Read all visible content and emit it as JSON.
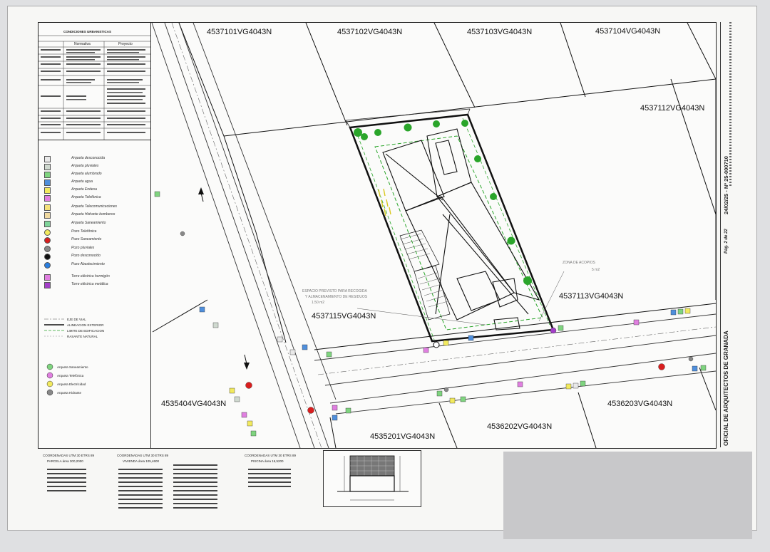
{
  "parcels": {
    "p1": "4537101VG4043N",
    "p2": "4537102VG4043N",
    "p3": "4537103VG4043N",
    "p4": "4537104VG4043N",
    "p5": "4537112VG4043N",
    "p6": "4537113VG4043N",
    "p7": "4537115VG4043N",
    "p8": "4535404VG4043N",
    "p9": "4536203VG4043N",
    "p10": "4536202VG4043N",
    "p11": "4535201VG4043N"
  },
  "conditions": {
    "title": "CONDICIONES URBANISTICAS",
    "col_norm": "Normativa",
    "col_proj": "Proyecto"
  },
  "legend": [
    {
      "label": "Arqueta desconocida",
      "color": "#e9e9e9",
      "shape": "sq"
    },
    {
      "label": "Arqueta pluviales",
      "color": "#cfd9cf",
      "shape": "sq"
    },
    {
      "label": "Arqueta alumbrado",
      "color": "#7fd47f",
      "shape": "sq"
    },
    {
      "label": "Arqueta agua",
      "color": "#4f8fdc",
      "shape": "sq"
    },
    {
      "label": "Arqueta Endesa",
      "color": "#f2ea5e",
      "shape": "sq"
    },
    {
      "label": "Arqueta Telefónica",
      "color": "#e07fe0",
      "shape": "sq"
    },
    {
      "label": "Arqueta Telecomunicaciones",
      "color": "#f5e27a",
      "shape": "sq"
    },
    {
      "label": "Arqueta Hidrante bomberos",
      "color": "#f0d9a0",
      "shape": "sq"
    },
    {
      "label": "Arqueta Saneamiento",
      "color": "#7fd49a",
      "shape": "sq"
    },
    {
      "label": "Pozo Telefónica",
      "color": "#f2ea5e",
      "shape": "ci"
    },
    {
      "label": "Pozo Saneamiento",
      "color": "#d81e1e",
      "shape": "ci"
    },
    {
      "label": "Pozo pluviales",
      "color": "#888888",
      "shape": "ci"
    },
    {
      "label": "Pozo desconocido",
      "color": "#111111",
      "shape": "ci"
    },
    {
      "label": "Pozo Abastecimiento",
      "color": "#2a7fe0",
      "shape": "ci"
    },
    {
      "label": "Torre eléctrica hormigón",
      "color": "#e07fe0",
      "shape": "sq"
    },
    {
      "label": "Torre eléctrica metálica",
      "color": "#a33fc8",
      "shape": "sq"
    }
  ],
  "line_legend": [
    "EJE DE VIAL",
    "ALINEACION EXTERIOR",
    "LIMITE DE EDIFICACION",
    "RASANTE NATURAL"
  ],
  "hydrant_legend": [
    "Arqueta Saneamiento",
    "Arqueta Telefónica",
    "Arqueta Electricidad",
    "Arqueta Hidrante"
  ],
  "annotations": {
    "zone": "ZONA DE ACOPIOS",
    "zone_area": "5 m2",
    "space1": "ESPACIO PREVISTO PARA RECOGIDA",
    "space2": "Y ALMACENAMIENTO DE RESIDUOS",
    "space3": "1.50 m2"
  },
  "coords": {
    "h1": "COORDENADAS UTM 30 ETRS 89",
    "h2": "COORDENADAS UTM 30 ETRS 89",
    "h3": "COORDENADAS UTM 30 ETRS 89",
    "s1": "PARCELA  área  300,2000",
    "s2": "VIVIENDA  área  105,4600",
    "s3": "PISCINA  área  16,5200"
  },
  "side_stamp": {
    "college": "OFICIAL DE ARQUITECTOS DE GRANADA",
    "visado": "24/02/25 - Nº 25-000710",
    "page": "Pág. 2 de 22"
  },
  "colors": {
    "tree": "#2aa52a",
    "building_line": "#111111",
    "setback": "#2aa52a"
  }
}
